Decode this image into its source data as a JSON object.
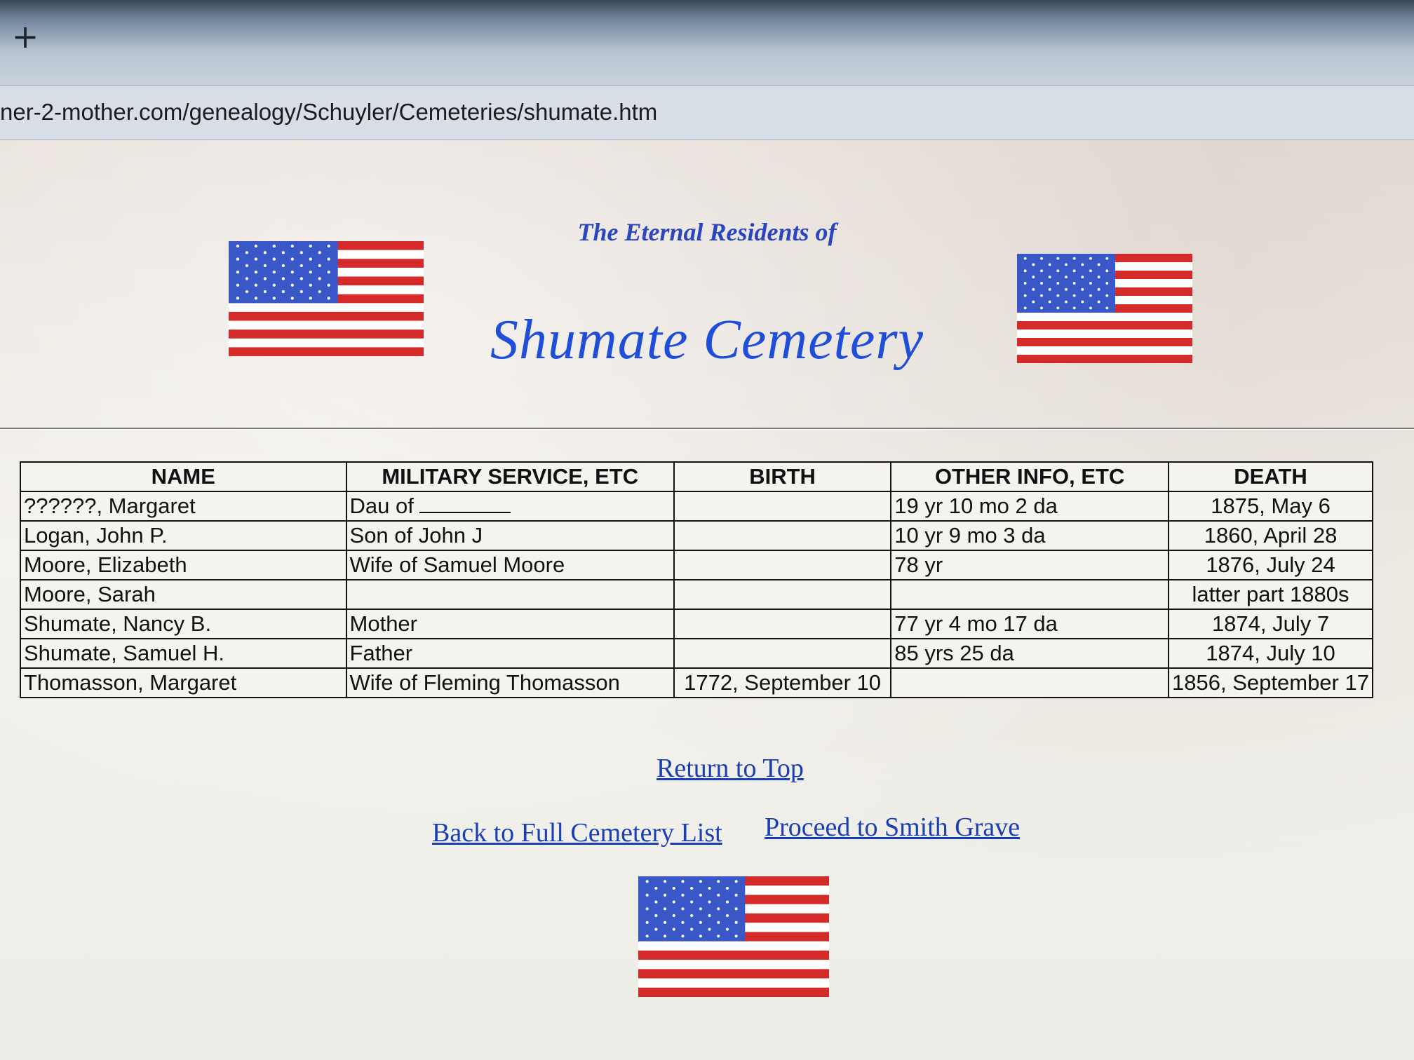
{
  "browser": {
    "new_tab_symbol": "+",
    "url": "ner-2-mother.com/genealogy/Schuyler/Cemeteries/shumate.htm"
  },
  "header": {
    "subtitle": "The Eternal Residents of",
    "title": "Shumate Cemetery"
  },
  "table": {
    "columns": [
      "NAME",
      "MILITARY SERVICE, ETC",
      "BIRTH",
      "OTHER INFO, ETC",
      "DEATH"
    ],
    "rows": [
      {
        "name": "??????, Margaret",
        "service": "Dau of",
        "service_blank": true,
        "birth": "",
        "other": "19 yr 10 mo 2 da",
        "death": "1875, May 6"
      },
      {
        "name": "Logan, John P.",
        "service": "Son of John J",
        "birth": "",
        "other": "10 yr 9 mo 3 da",
        "death": "1860, April 28"
      },
      {
        "name": "Moore, Elizabeth",
        "service": "Wife of Samuel Moore",
        "birth": "",
        "other": "78 yr",
        "death": "1876, July 24"
      },
      {
        "name": "Moore, Sarah",
        "service": "",
        "birth": "",
        "other": "",
        "death": "latter part 1880s"
      },
      {
        "name": "Shumate, Nancy B.",
        "service": "Mother",
        "birth": "",
        "other": "77 yr 4 mo 17 da",
        "death": "1874, July 7"
      },
      {
        "name": "Shumate, Samuel H.",
        "service": "Father",
        "birth": "",
        "other": "85 yrs 25 da",
        "death": "1874, July 10"
      },
      {
        "name": "Thomasson, Margaret",
        "service": "Wife of Fleming Thomasson",
        "birth": "1772, September 10",
        "other": "",
        "death": "1856, September 17"
      }
    ]
  },
  "links": {
    "return_top": "Return to Top",
    "back_list": "Back to Full Cemetery List",
    "proceed": "Proceed to Smith Grave"
  },
  "colors": {
    "flag_red": "#d42a2a",
    "flag_blue": "#3a57c8",
    "title_blue": "#1f4fd8",
    "link_blue": "#1a3fb5"
  },
  "icons": [
    "plus-icon",
    "us-flag-icon"
  ]
}
